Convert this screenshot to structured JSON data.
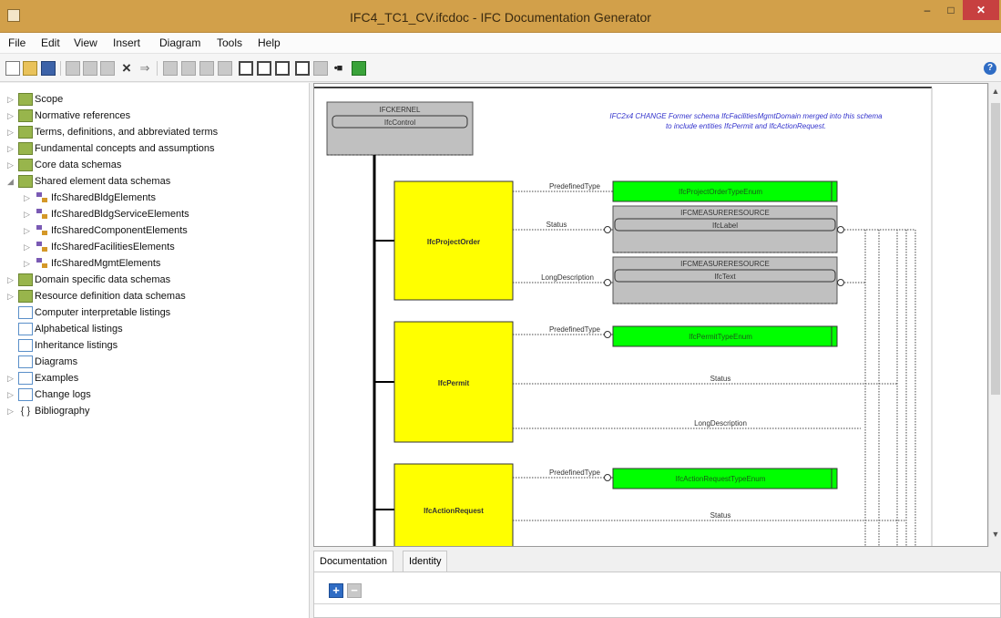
{
  "window": {
    "title": "IFC4_TC1_CV.ifcdoc - IFC Documentation Generator",
    "minimize": "–",
    "maximize": "□",
    "close": "✕"
  },
  "menu": [
    "File",
    "Edit",
    "View",
    "Insert",
    "Diagram",
    "Tools",
    "Help"
  ],
  "toolbar": {
    "icons": [
      "new-document-icon",
      "open-folder-icon",
      "save-icon",
      "cut-icon",
      "copy-icon",
      "paste-icon",
      "delete-icon",
      "move-icon",
      "grid-icon-1",
      "grid-icon-2",
      "grid-icon-3",
      "grid-icon-4",
      "diagram-view-icon-1",
      "diagram-view-icon-2",
      "diagram-view-icon-3",
      "select-icon",
      "rectangle-icon",
      "connector-icon",
      "build-icon",
      "help-icon"
    ]
  },
  "tree": {
    "items": [
      {
        "label": "Scope",
        "expander": "▷",
        "icon": "folder"
      },
      {
        "label": "Normative references",
        "expander": "▷",
        "icon": "folder"
      },
      {
        "label": "Terms, definitions, and abbreviated terms",
        "expander": "▷",
        "icon": "folder"
      },
      {
        "label": "Fundamental concepts and assumptions",
        "expander": "▷",
        "icon": "folder"
      },
      {
        "label": "Core data schemas",
        "expander": "▷",
        "icon": "folder"
      },
      {
        "label": "Shared element data schemas",
        "expander": "◢",
        "icon": "folder"
      },
      {
        "label": "IfcSharedBldgElements",
        "expander": "▷",
        "icon": "schema"
      },
      {
        "label": "IfcSharedBldgServiceElements",
        "expander": "▷",
        "icon": "schema"
      },
      {
        "label": "IfcSharedComponentElements",
        "expander": "▷",
        "icon": "schema"
      },
      {
        "label": "IfcSharedFacilitiesElements",
        "expander": "▷",
        "icon": "schema"
      },
      {
        "label": "IfcSharedMgmtElements",
        "expander": "▷",
        "icon": "schema"
      },
      {
        "label": "Domain specific data schemas",
        "expander": "▷",
        "icon": "folder"
      },
      {
        "label": "Resource definition data schemas",
        "expander": "▷",
        "icon": "folder"
      },
      {
        "label": "Computer interpretable listings",
        "expander": "",
        "icon": "page"
      },
      {
        "label": "Alphabetical listings",
        "expander": "",
        "icon": "page"
      },
      {
        "label": "Inheritance listings",
        "expander": "",
        "icon": "page"
      },
      {
        "label": "Diagrams",
        "expander": "",
        "icon": "page"
      },
      {
        "label": "Examples",
        "expander": "▷",
        "icon": "page"
      },
      {
        "label": "Change logs",
        "expander": "▷",
        "icon": "page"
      },
      {
        "label": "Bibliography",
        "expander": "▷",
        "icon": "braces"
      }
    ]
  },
  "diagram": {
    "note": "IFC2x4 CHANGE Former schema IfcFacilitiesMgmtDomain merged into this schema to include entities IfcPermit and IfcActionRequest.",
    "kernel_schema": "IFCKERNEL",
    "kernel_entity": "IfcControl",
    "entities": [
      {
        "name": "IfcProjectOrder"
      },
      {
        "name": "IfcPermit"
      },
      {
        "name": "IfcActionRequest"
      }
    ],
    "enums": [
      {
        "name": "IfcProjectOrderTypeEnum"
      },
      {
        "name": "IfcPermitTypeEnum"
      },
      {
        "name": "IfcActionRequestTypeEnum"
      }
    ],
    "refs": [
      {
        "schema": "IFCMEASURERESOURCE",
        "type": "IfcLabel"
      },
      {
        "schema": "IFCMEASURERESOURCE",
        "type": "IfcText"
      }
    ],
    "attributes": {
      "predefined_type": "PredefinedType",
      "status": "Status",
      "long_description": "LongDescription"
    },
    "colors": {
      "entity": "#ffff00",
      "enum": "#00ff00",
      "ref": "#c0c0c0",
      "note": "#3333cc"
    }
  },
  "bottom": {
    "tabs": [
      "Documentation",
      "Identity"
    ],
    "plus": "+",
    "minus": "−"
  }
}
